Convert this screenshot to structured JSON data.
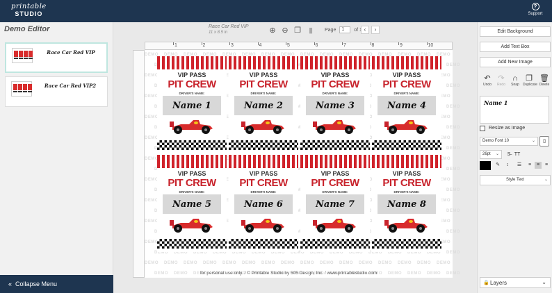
{
  "header": {
    "logo_line1": "printable",
    "logo_line2": "STUDIO",
    "support_label": "Support"
  },
  "left_panel": {
    "title": "Demo Editor",
    "designs": [
      {
        "name": "Race Car Red VIP",
        "active": true
      },
      {
        "name": "Race Car Red VIP2",
        "active": false
      }
    ],
    "collapse_label": "Collapse Menu"
  },
  "canvas": {
    "doc_title": "Race Car Red VIP",
    "doc_size": "11 x 8.5 in",
    "page_label": "Page",
    "page_value": "1",
    "page_of": "of 1",
    "ruler_numbers": [
      "1",
      "2",
      "3",
      "4",
      "5",
      "6",
      "7",
      "8",
      "9",
      "10"
    ],
    "watermark": "DEMO",
    "footer_text": "for personal use only.   /   © Printable Studio by 505 Design, Inc.   /   www.printablestudio.com"
  },
  "badge_text": {
    "vip": "VIP PASS",
    "pit": "PIT CREW",
    "driver": "DRIVER'S NAME:"
  },
  "badges": [
    {
      "name": "Name 1"
    },
    {
      "name": "Name 2"
    },
    {
      "name": "Name 3"
    },
    {
      "name": "Name 4"
    },
    {
      "name": "Name 5"
    },
    {
      "name": "Name 6"
    },
    {
      "name": "Name 7"
    },
    {
      "name": "Name 8"
    }
  ],
  "right_panel": {
    "edit_background": "Edit Background",
    "add_text_box": "Add Text Box",
    "add_new_image": "Add New Image",
    "tools": [
      {
        "label": "Undo",
        "icon": "undo-icon",
        "glyph": "↶",
        "enabled": true
      },
      {
        "label": "Redo",
        "icon": "redo-icon",
        "glyph": "↷",
        "enabled": false
      },
      {
        "label": "Snap",
        "icon": "magnet-icon",
        "glyph": "∩",
        "enabled": true
      },
      {
        "label": "Duplicate",
        "icon": "duplicate-icon",
        "glyph": "❐",
        "enabled": true
      },
      {
        "label": "Delete",
        "icon": "trash-icon",
        "glyph": "🗑",
        "enabled": true
      }
    ],
    "text_value": "Name 1",
    "resize_label": "Resize as Image",
    "font_value": "Demo Font 10",
    "size_value": "26pt",
    "style_text_label": "Style Text",
    "layers_label": "Layers",
    "text_color": "#000000"
  },
  "colors": {
    "brand": "#1e3550",
    "badge_red": "#c8232c"
  }
}
